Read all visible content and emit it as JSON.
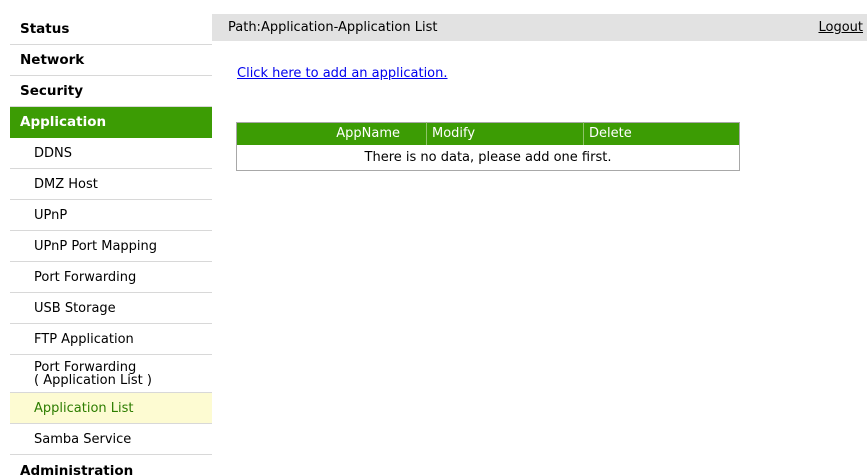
{
  "sidebar": {
    "status": "Status",
    "network": "Network",
    "security": "Security",
    "application": "Application",
    "sub_items": {
      "ddns": "DDNS",
      "dmz_host": "DMZ Host",
      "upnp": "UPnP",
      "upnp_port_mapping": "UPnP Port Mapping",
      "port_forwarding": "Port Forwarding",
      "usb_storage": "USB Storage",
      "ftp_application": "FTP Application",
      "port_forwarding_app_list_line1": "Port Forwarding",
      "port_forwarding_app_list_line2": "( Application List )",
      "application_list": "Application List",
      "samba_service": "Samba Service"
    },
    "administration": "Administration"
  },
  "header": {
    "path": "Path:Application-Application List",
    "logout": "Logout"
  },
  "main": {
    "add_link": "Click here to add an application.",
    "table": {
      "columns": [
        "AppName",
        "Modify",
        "Delete"
      ],
      "empty_message": "There is no data, please add one first."
    }
  },
  "colors": {
    "accent_green": "#3c9c04",
    "selected_bg": "#fdfbd2",
    "header_bar": "#e2e2e2",
    "link_blue": "#0000ee"
  }
}
